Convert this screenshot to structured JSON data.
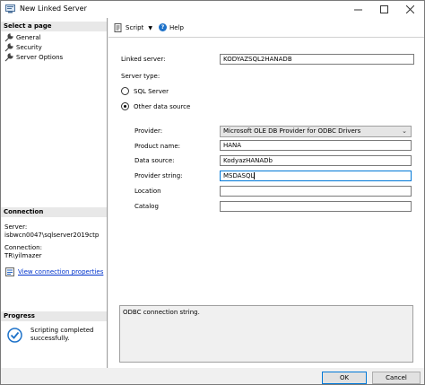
{
  "window": {
    "title": "New Linked Server"
  },
  "left": {
    "select_page_header": "Select a page",
    "pages": [
      "General",
      "Security",
      "Server Options"
    ],
    "connection_header": "Connection",
    "server_label": "Server:",
    "server_value": "isbwcn0047\\sqlserver2019ctp",
    "connection_label": "Connection:",
    "connection_value": "TR\\yilmazer",
    "view_props_link": "View connection properties",
    "progress_header": "Progress",
    "progress_status": "Scripting completed successfully."
  },
  "toolbar": {
    "script_label": "Script",
    "help_label": "Help"
  },
  "form": {
    "linked_server_label": "Linked server:",
    "linked_server_value": "KODYAZSQL2HANADB",
    "server_type_label": "Server type:",
    "sql_server_label": "SQL Server",
    "other_source_label": "Other data source",
    "provider_label": "Provider:",
    "provider_value": "Microsoft OLE DB Provider for ODBC Drivers",
    "product_name_label": "Product name:",
    "product_name_value": "HANA",
    "data_source_label": "Data source:",
    "data_source_value": "KodyazHANADb",
    "provider_string_label": "Provider string:",
    "provider_string_value": "MSDASQL",
    "location_label": "Location",
    "location_value": "",
    "catalog_label": "Catalog",
    "catalog_value": "",
    "description": "ODBC connection string."
  },
  "buttons": {
    "ok": "OK",
    "cancel": "Cancel"
  }
}
